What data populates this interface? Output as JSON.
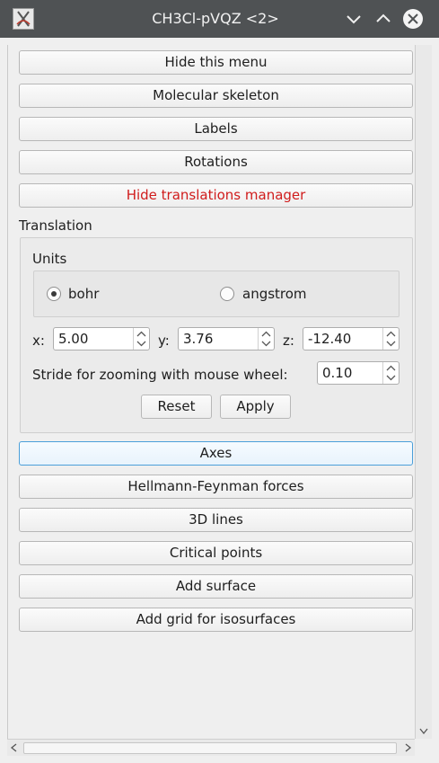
{
  "window": {
    "title": "CH3Cl-pVQZ <2>"
  },
  "buttons": {
    "hide_menu": "Hide this menu",
    "molecular_skeleton": "Molecular skeleton",
    "labels": "Labels",
    "rotations": "Rotations",
    "hide_translations": "Hide translations manager",
    "axes": "Axes",
    "hellmann_feynman": "Hellmann-Feynman forces",
    "lines_3d": "3D lines",
    "critical_points": "Critical points",
    "add_surface": "Add surface",
    "add_grid": "Add grid for isosurfaces"
  },
  "translation": {
    "group_title": "Translation",
    "units_title": "Units",
    "unit_options": [
      "bohr",
      "angstrom"
    ],
    "selected_unit": "bohr",
    "x_label": "x:",
    "x_value": "5.00",
    "y_label": "y:",
    "y_value": "3.76",
    "z_label": "z:",
    "z_value": "-12.40",
    "stride_label": "Stride for zooming with mouse wheel:",
    "stride_value": "0.10",
    "reset_label": "Reset",
    "apply_label": "Apply"
  },
  "colors": {
    "titlebar": "#4f5254",
    "alert_text": "#d01c1c",
    "focus_border": "#4b9fd9"
  }
}
